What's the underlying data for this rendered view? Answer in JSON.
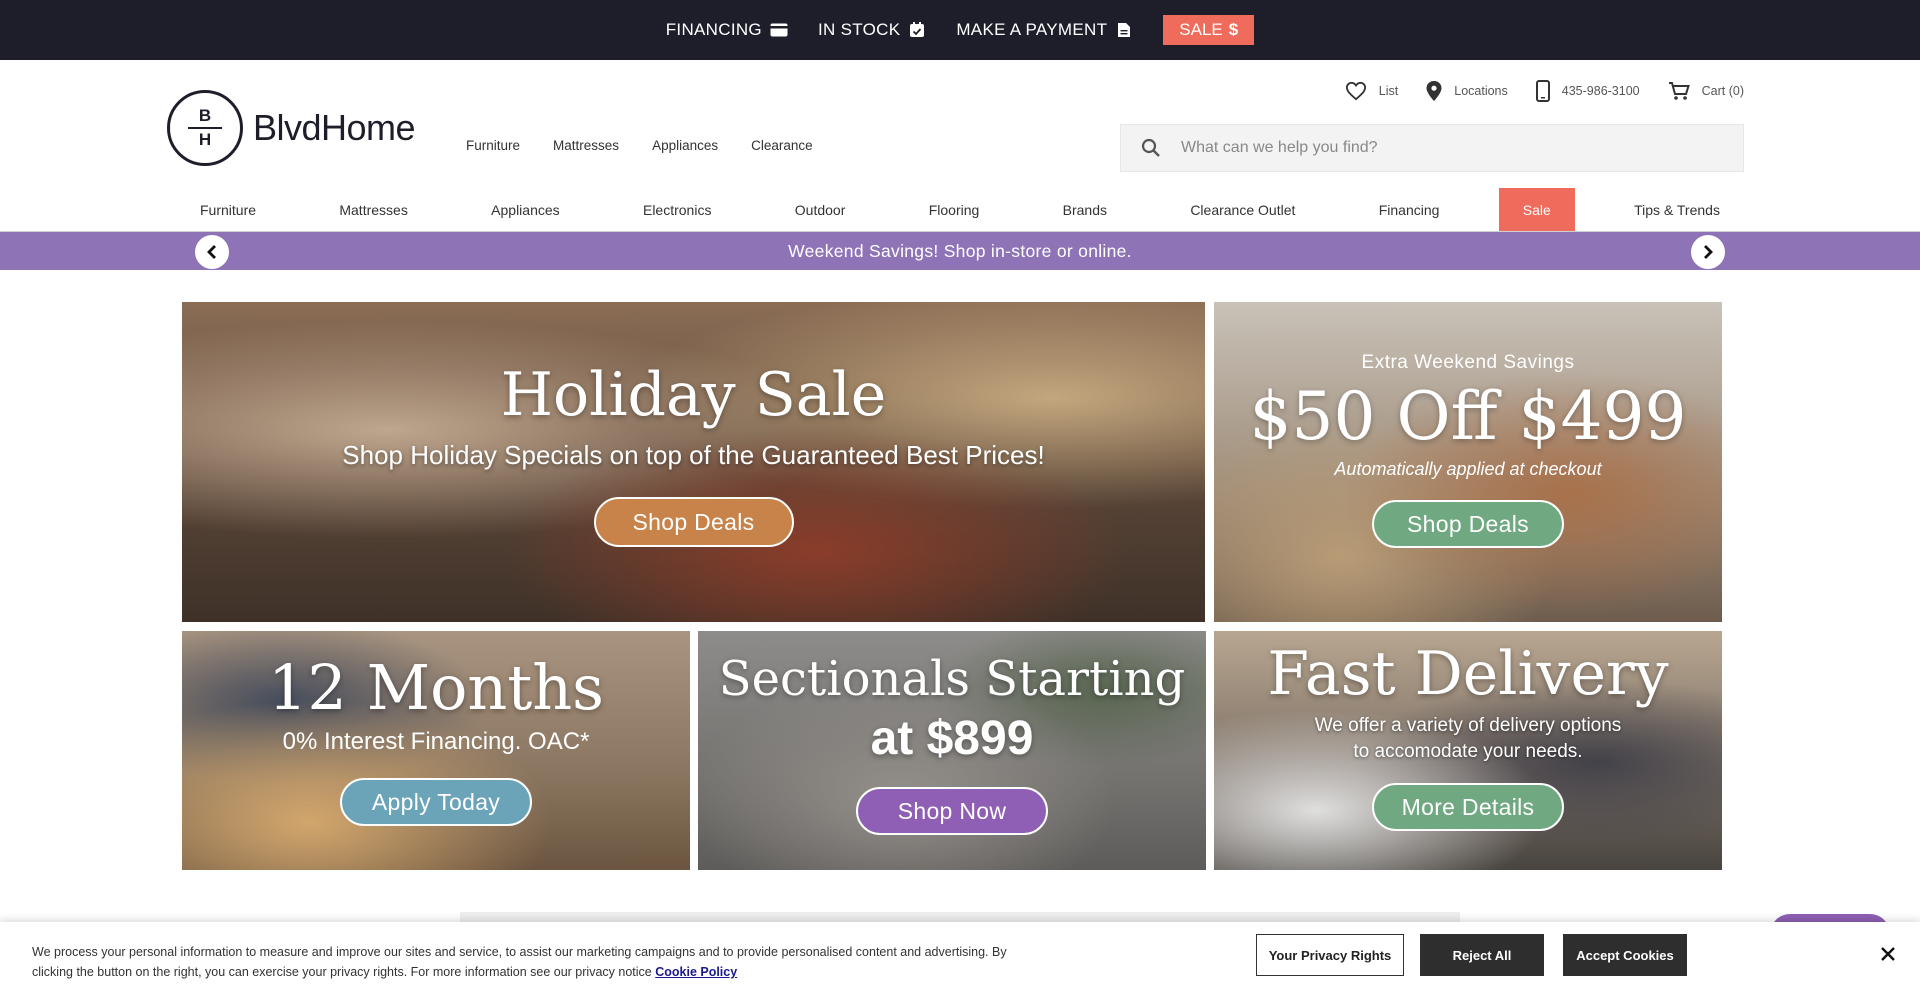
{
  "topbar": {
    "financing": "FINANCING",
    "in_stock": "IN STOCK",
    "make_payment": "MAKE A PAYMENT",
    "sale": "SALE",
    "bg_color": "#1e1e2b",
    "sale_color": "#ef6b5c"
  },
  "logo": {
    "letter_top": "B",
    "letter_bottom": "H",
    "name": "BlvdHome"
  },
  "header_nav": [
    "Furniture",
    "Mattresses",
    "Appliances",
    "Clearance"
  ],
  "utilities": {
    "list": "List",
    "locations": "Locations",
    "phone": "435-986-3100",
    "cart": "Cart (0)"
  },
  "search": {
    "placeholder": "What can we help you find?"
  },
  "main_nav": [
    {
      "label": "Furniture"
    },
    {
      "label": "Mattresses"
    },
    {
      "label": "Appliances"
    },
    {
      "label": "Electronics"
    },
    {
      "label": "Outdoor"
    },
    {
      "label": "Flooring"
    },
    {
      "label": "Brands"
    },
    {
      "label": "Clearance Outlet"
    },
    {
      "label": "Financing"
    },
    {
      "label": "Sale"
    },
    {
      "label": "Tips & Trends"
    }
  ],
  "promo_bar": {
    "text": "Weekend Savings! Shop in-store or online.",
    "color": "#8e73b7"
  },
  "banners": {
    "holiday": {
      "title": "Holiday Sale",
      "subtitle": "Shop Holiday Specials on top of the Guaranteed Best Prices!",
      "button": "Shop Deals"
    },
    "weekend": {
      "kicker": "Extra Weekend Savings",
      "title": "$50 Off $499",
      "subtitle": "Automatically applied at checkout",
      "button": "Shop Deals"
    },
    "financing": {
      "title": "12 Months",
      "subtitle": "0% Interest Financing. OAC*",
      "button": "Apply Today"
    },
    "sectionals": {
      "title_line1": "Sectionals Starting",
      "title_line2": "at $899",
      "button": "Shop Now"
    },
    "delivery": {
      "title": "Fast Delivery",
      "subtitle_line1": "We offer a variety of delivery options",
      "subtitle_line2": "to accomodate your needs.",
      "button": "More Details"
    }
  },
  "cookie": {
    "text_line1": "We process your personal information to measure and improve our sites and service, to assist our marketing campaigns and to provide personalised content and advertising. By",
    "text_line2": "clicking the button on the right, you can exercise your privacy rights. For more information see our privacy notice",
    "policy_link": "Cookie Policy",
    "privacy_rights": "Your Privacy Rights",
    "reject_all": "Reject All",
    "accept_cookies": "Accept Cookies"
  }
}
